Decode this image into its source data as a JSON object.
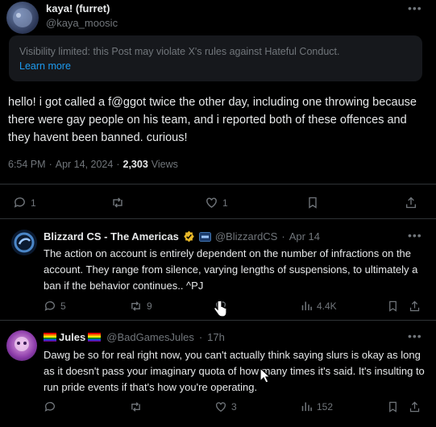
{
  "tweet": {
    "author_name": "kaya! (furret)",
    "handle": "@kaya_moosic",
    "notice": {
      "text": "Visibility limited: this Post may violate X's rules against Hateful Conduct.",
      "link": "Learn more"
    },
    "body": "hello! i got called a f@ggot twice the other day, including one throwing because there were gay people on his team, and i reported both of these offences and they havent been banned. curious!",
    "time": "6:54 PM",
    "sep": "·",
    "date": "Apr 14, 2024",
    "views_count": "2,303",
    "views_label": "Views",
    "replies": "1",
    "likes": "1"
  },
  "reply1": {
    "name": "Blizzard CS - The Americas",
    "handle": "@BlizzardCS",
    "sep": "·",
    "date": "Apr 14",
    "body": "The action on account is entirely dependent on the number of infractions on the account.  They range from silence, varying lengths of suspensions, to ultimately a ban if the behavior continues..  ^PJ",
    "replies": "5",
    "reposts": "9",
    "views": "4.4K"
  },
  "reply2": {
    "name": "Jules",
    "handle": "@BadGamesJules",
    "sep": "·",
    "time": "17h",
    "body": "Dawg be so for real right now, you can't actually think saying slurs is okay as long as it doesn't pass your imaginary quota of how many times it's said. It's insulting to run pride events if that's how you're operating.",
    "likes": "3",
    "views": "152"
  },
  "icons": {
    "reply": "reply-icon",
    "repost": "repost-icon",
    "like": "heart-icon",
    "bookmark": "bookmark-icon",
    "share": "share-icon",
    "views": "views-icon",
    "verified": "verified-badge-icon",
    "more": "more-icon",
    "cursor": "hand-cursor-icon"
  },
  "colors": {
    "background": "#000000",
    "text": "#e7e9ea",
    "muted": "#71767b",
    "link": "#1d9bf0",
    "notice_bg": "#16181c",
    "verified_gold": "#e8b829",
    "divider": "#2f3336"
  }
}
